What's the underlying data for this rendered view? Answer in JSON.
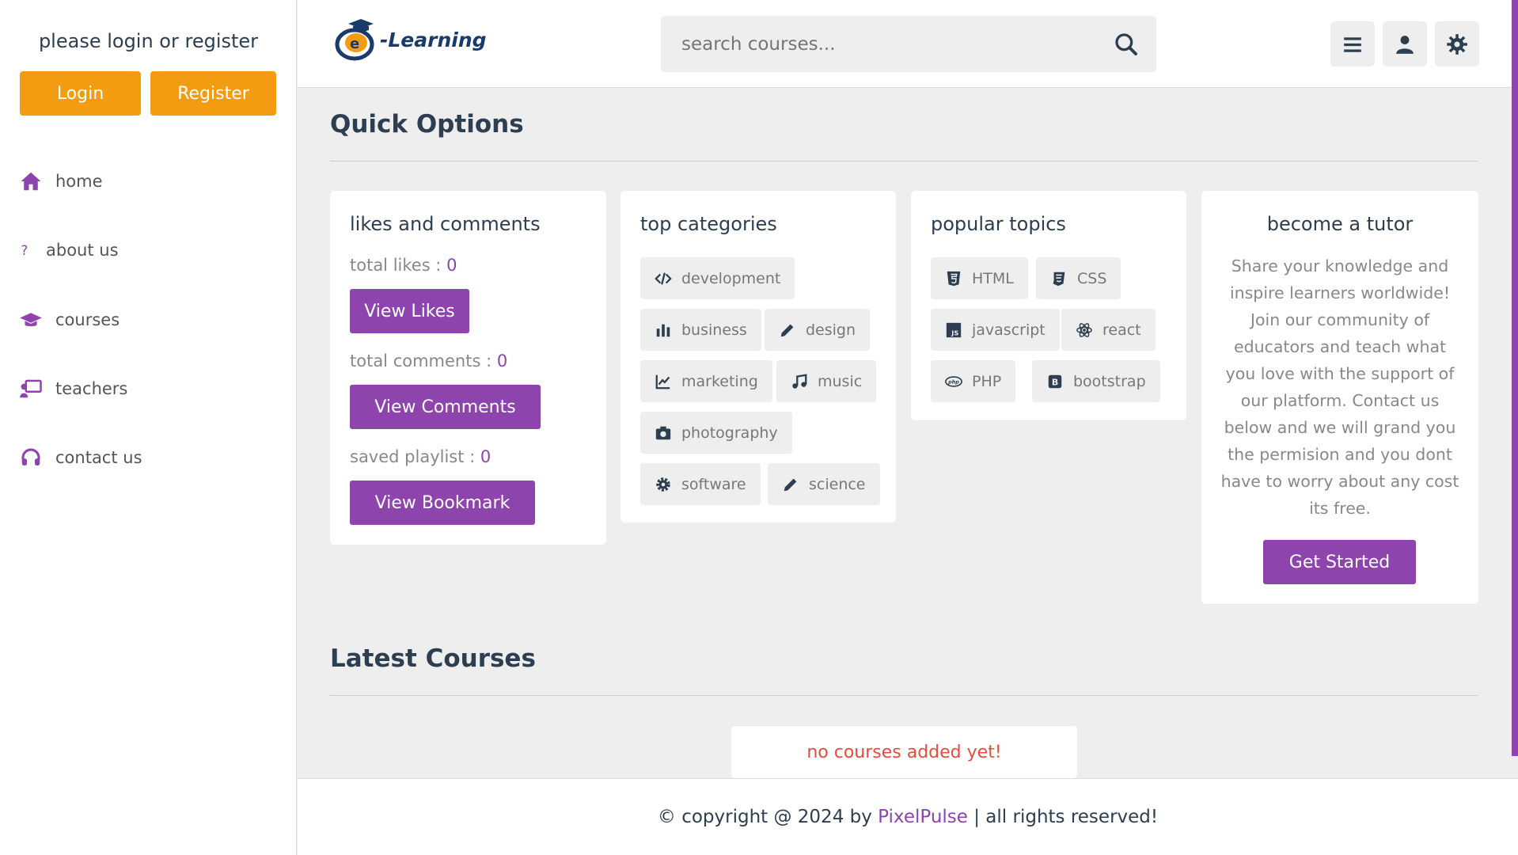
{
  "sidebar": {
    "title": "please login or register",
    "login_label": "Login",
    "register_label": "Register",
    "items": [
      {
        "label": "home",
        "icon": "house-icon"
      },
      {
        "label": "about us",
        "icon": "question-icon"
      },
      {
        "label": "courses",
        "icon": "graduation-cap-icon"
      },
      {
        "label": "teachers",
        "icon": "chalkboard-teacher-icon"
      },
      {
        "label": "contact us",
        "icon": "headset-icon"
      }
    ]
  },
  "header": {
    "logo_text": "-Learning",
    "search_placeholder": "search courses...",
    "icons": [
      "menu-icon",
      "user-icon",
      "settings-icon"
    ]
  },
  "quick_options": {
    "title": "Quick Options",
    "likes_card": {
      "title": "likes and comments",
      "likes_label": "total likes : ",
      "likes_value": "0",
      "view_likes": "View Likes",
      "comments_label": "total comments : ",
      "comments_value": "0",
      "view_comments": "View Comments",
      "playlist_label": "saved playlist : ",
      "playlist_value": "0",
      "view_bookmark": "View Bookmark"
    },
    "categories_card": {
      "title": "top categories",
      "tags": [
        "development",
        "business",
        "design",
        "marketing",
        "music",
        "photography",
        "software",
        "science"
      ]
    },
    "topics_card": {
      "title": "popular topics",
      "tags": [
        "HTML",
        "CSS",
        "javascript",
        "react",
        "PHP",
        "bootstrap"
      ]
    },
    "tutor_card": {
      "title": "become a tutor",
      "text": "Share your knowledge and inspire learners worldwide! Join our community of educators and teach what you love with the support of our platform. Contact us below and we will grand you the permision and you dont have to worry about any cost its free.",
      "button": "Get Started"
    }
  },
  "latest_courses": {
    "title": "Latest Courses",
    "empty_message": "no courses added yet!"
  },
  "footer": {
    "prefix": "© copyright @ 2024 by ",
    "brand": "PixelPulse",
    "suffix": " | all rights reserved!"
  },
  "colors": {
    "accent": "#8e44ad",
    "orange": "#f39c12",
    "danger": "#e74c3c",
    "text": "#2c3e50"
  }
}
